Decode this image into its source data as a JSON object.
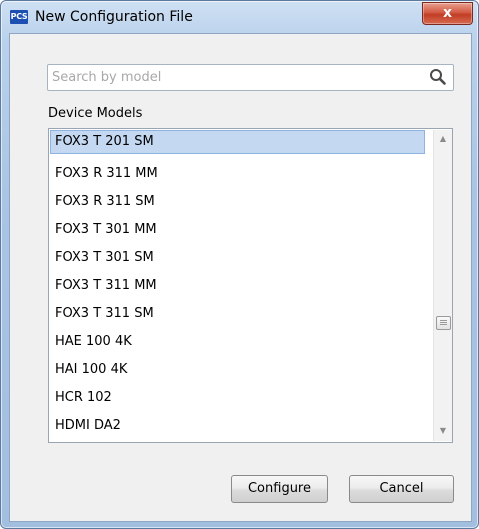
{
  "window": {
    "icon_text": "PCS",
    "title": "New Configuration File",
    "close_label": "x"
  },
  "search": {
    "placeholder": "Search by model",
    "value": ""
  },
  "device_models": {
    "label": "Device Models",
    "items": [
      {
        "label": "FOX3 T 201 SM",
        "selected": true
      },
      {
        "label": "FOX3 R 311 MM"
      },
      {
        "label": "FOX3 R 311 SM"
      },
      {
        "label": "FOX3 T 301 MM"
      },
      {
        "label": "FOX3 T 301 SM"
      },
      {
        "label": "FOX3 T 311 MM"
      },
      {
        "label": "FOX3 T 311 SM"
      },
      {
        "label": "HAE 100 4K"
      },
      {
        "label": "HAI 100 4K"
      },
      {
        "label": "HCR 102"
      },
      {
        "label": "HDMI DA2"
      }
    ]
  },
  "buttons": {
    "configure": "Configure",
    "cancel": "Cancel"
  }
}
